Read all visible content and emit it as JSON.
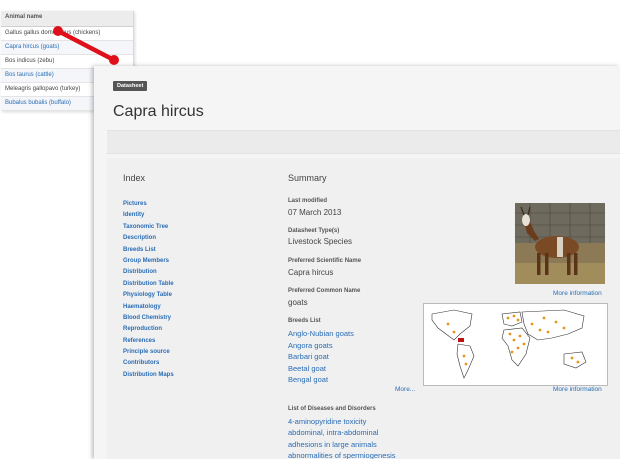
{
  "animal_list": {
    "header": "Animal name",
    "rows": [
      "Gallus gallus domesticus (chickens)",
      "Capra hircus (goats)",
      "Bos indicus (zebu)",
      "Bos taurus (cattle)",
      "Meleagris gallopavo (turkey)",
      "Bubalus bubalis (buffalo)"
    ]
  },
  "datasheet": {
    "badge": "Datasheet",
    "title": "Capra hircus",
    "index": {
      "heading": "Index",
      "items": [
        "Pictures",
        "Identity",
        "Taxonomic Tree",
        "Description",
        "Breeds List",
        "Group Members",
        "Distribution",
        "Distribution Table",
        "Physiology Table",
        "Haematology",
        "Blood Chemistry",
        "Reproduction",
        "References",
        "Principle source",
        "Contributors",
        "Distribution Maps"
      ]
    },
    "summary": {
      "heading": "Summary",
      "last_modified_label": "Last modified",
      "last_modified": "07 March 2013",
      "datasheet_type_label": "Datasheet Type(s)",
      "datasheet_type": "Livestock Species",
      "scientific_name_label": "Preferred Scientific Name",
      "scientific_name": "Capra hircus",
      "common_name_label": "Preferred Common Name",
      "common_name": "goats",
      "breeds_label": "Breeds List",
      "breeds": [
        "Anglo-Nubian goats",
        "Angora goats",
        "Barbari goat",
        "Beetal goat",
        "Bengal goat"
      ],
      "breeds_more": "More...",
      "diseases_label": "List of Diseases and Disorders",
      "diseases": [
        "4-aminopyridine toxicity",
        "abdominal, intra-abdominal",
        "adhesions in large animals",
        "abnormalities of spermiogenesis"
      ]
    },
    "photo_more": "More information",
    "map_more": "More information"
  },
  "colors": {
    "link": "#2a6db5",
    "pointer": "#e0101a",
    "badge_bg": "#555555",
    "map_highlight": "#e8941a"
  },
  "icons": {
    "pointer": "red-arrow-pointer"
  }
}
